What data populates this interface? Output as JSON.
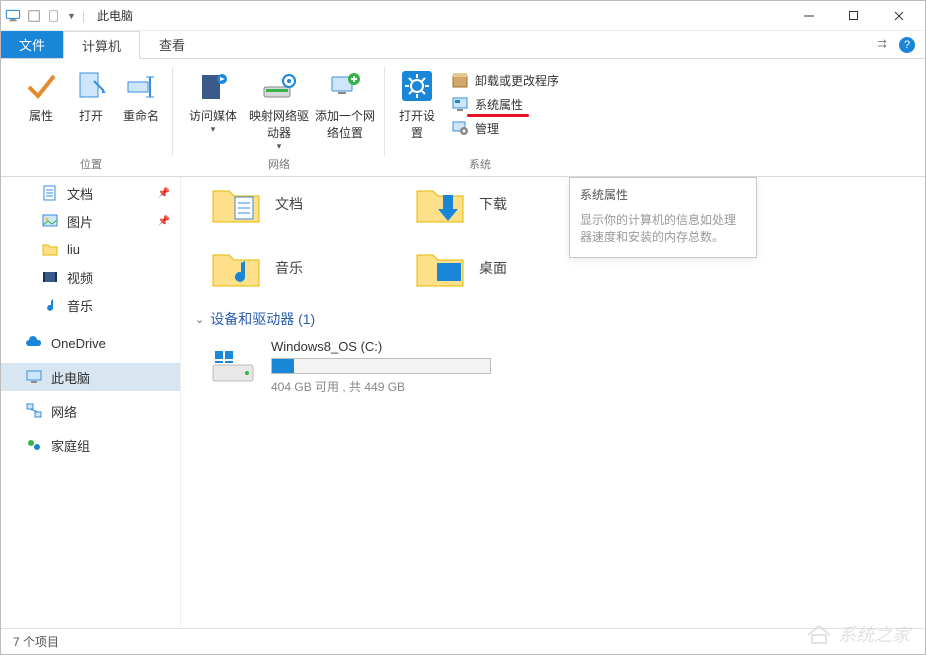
{
  "title": "此电脑",
  "tabs": {
    "file": "文件",
    "computer": "计算机",
    "view": "查看"
  },
  "ribbon": {
    "group_location": "位置",
    "group_network": "网络",
    "group_system": "系统",
    "properties": "属性",
    "open": "打开",
    "rename": "重命名",
    "access_media": "访问媒体",
    "map_drive": "映射网络驱动器",
    "add_location": "添加一个网络位置",
    "open_settings": "打开设置",
    "uninstall": "卸载或更改程序",
    "system_props": "系统属性",
    "manage": "管理"
  },
  "sidebar": {
    "documents": "文档",
    "pictures": "图片",
    "liu": "liu",
    "videos": "视频",
    "music": "音乐",
    "onedrive": "OneDrive",
    "thispc": "此电脑",
    "network": "网络",
    "homegroup": "家庭组"
  },
  "folders": {
    "documents": "文档",
    "music": "音乐",
    "downloads": "下载",
    "desktop": "桌面"
  },
  "section_devices": "设备和驱动器 (1)",
  "drive": {
    "name": "Windows8_OS (C:)",
    "subtitle": "404 GB 可用 , 共 449 GB",
    "used_pct": 10
  },
  "tooltip": {
    "title": "系统属性",
    "body1": "显示你的计算机的信息如处理器速度和安装的内存总数。"
  },
  "status": "7 个项目",
  "watermark": "系统之家"
}
